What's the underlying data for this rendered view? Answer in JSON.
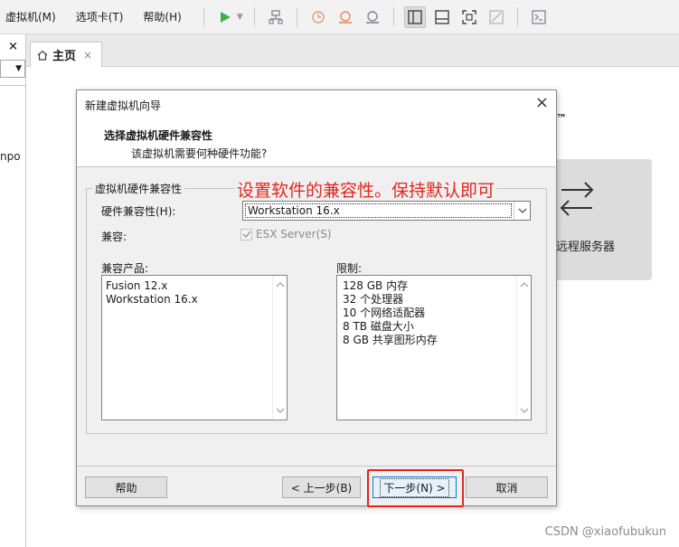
{
  "menu": {
    "items": [
      "虚拟机(M)",
      "选项卡(T)",
      "帮助(H)"
    ]
  },
  "toolbar": {
    "icons": [
      "play-icon",
      "network-icon",
      "snapshot-icon",
      "revert-snapshot-icon",
      "manage-snapshots-icon",
      "sidebar-view-icon",
      "console-view-icon",
      "fullscreen-icon",
      "unity-icon",
      "terminal-icon"
    ]
  },
  "left_pane": {
    "close_symbol": "×",
    "partial_text": "npo"
  },
  "tabs": [
    {
      "label": "主页",
      "close_symbol": "×"
    }
  ],
  "background": {
    "brand_tm": "™",
    "remote_server_label": "远程服务器"
  },
  "dialog": {
    "title": "新建虚拟机向导",
    "close_symbol": "×",
    "heading": "选择虚拟机硬件兼容性",
    "subheading": "该虚拟机需要何种硬件功能?",
    "group_title": "虚拟机硬件兼容性",
    "hardware_label": "硬件兼容性(H):",
    "hardware_value": "Workstation 16.x",
    "compat_label": "兼容:",
    "esx_checkbox_label": "ESX Server(S)",
    "esx_checked": true,
    "esx_enabled": false,
    "products_label": "兼容产品:",
    "products": [
      "Fusion 12.x",
      "Workstation 16.x"
    ],
    "limits_label": "限制:",
    "limits": [
      "128 GB 内存",
      "32 个处理器",
      "10 个网络适配器",
      "8 TB 磁盘大小",
      "8 GB 共享图形内存"
    ],
    "buttons": {
      "help": "帮助",
      "back": "< 上一步(B)",
      "next": "下一步(N) >",
      "cancel": "取消"
    }
  },
  "annotation": {
    "text": "设置软件的兼容性。保持默认即可",
    "color": "#e5261f"
  },
  "watermark": "CSDN @xiaofubukun",
  "colors": {
    "accent": "#0078d7",
    "play": "#3fb24a",
    "highlight": "#e5261f"
  }
}
